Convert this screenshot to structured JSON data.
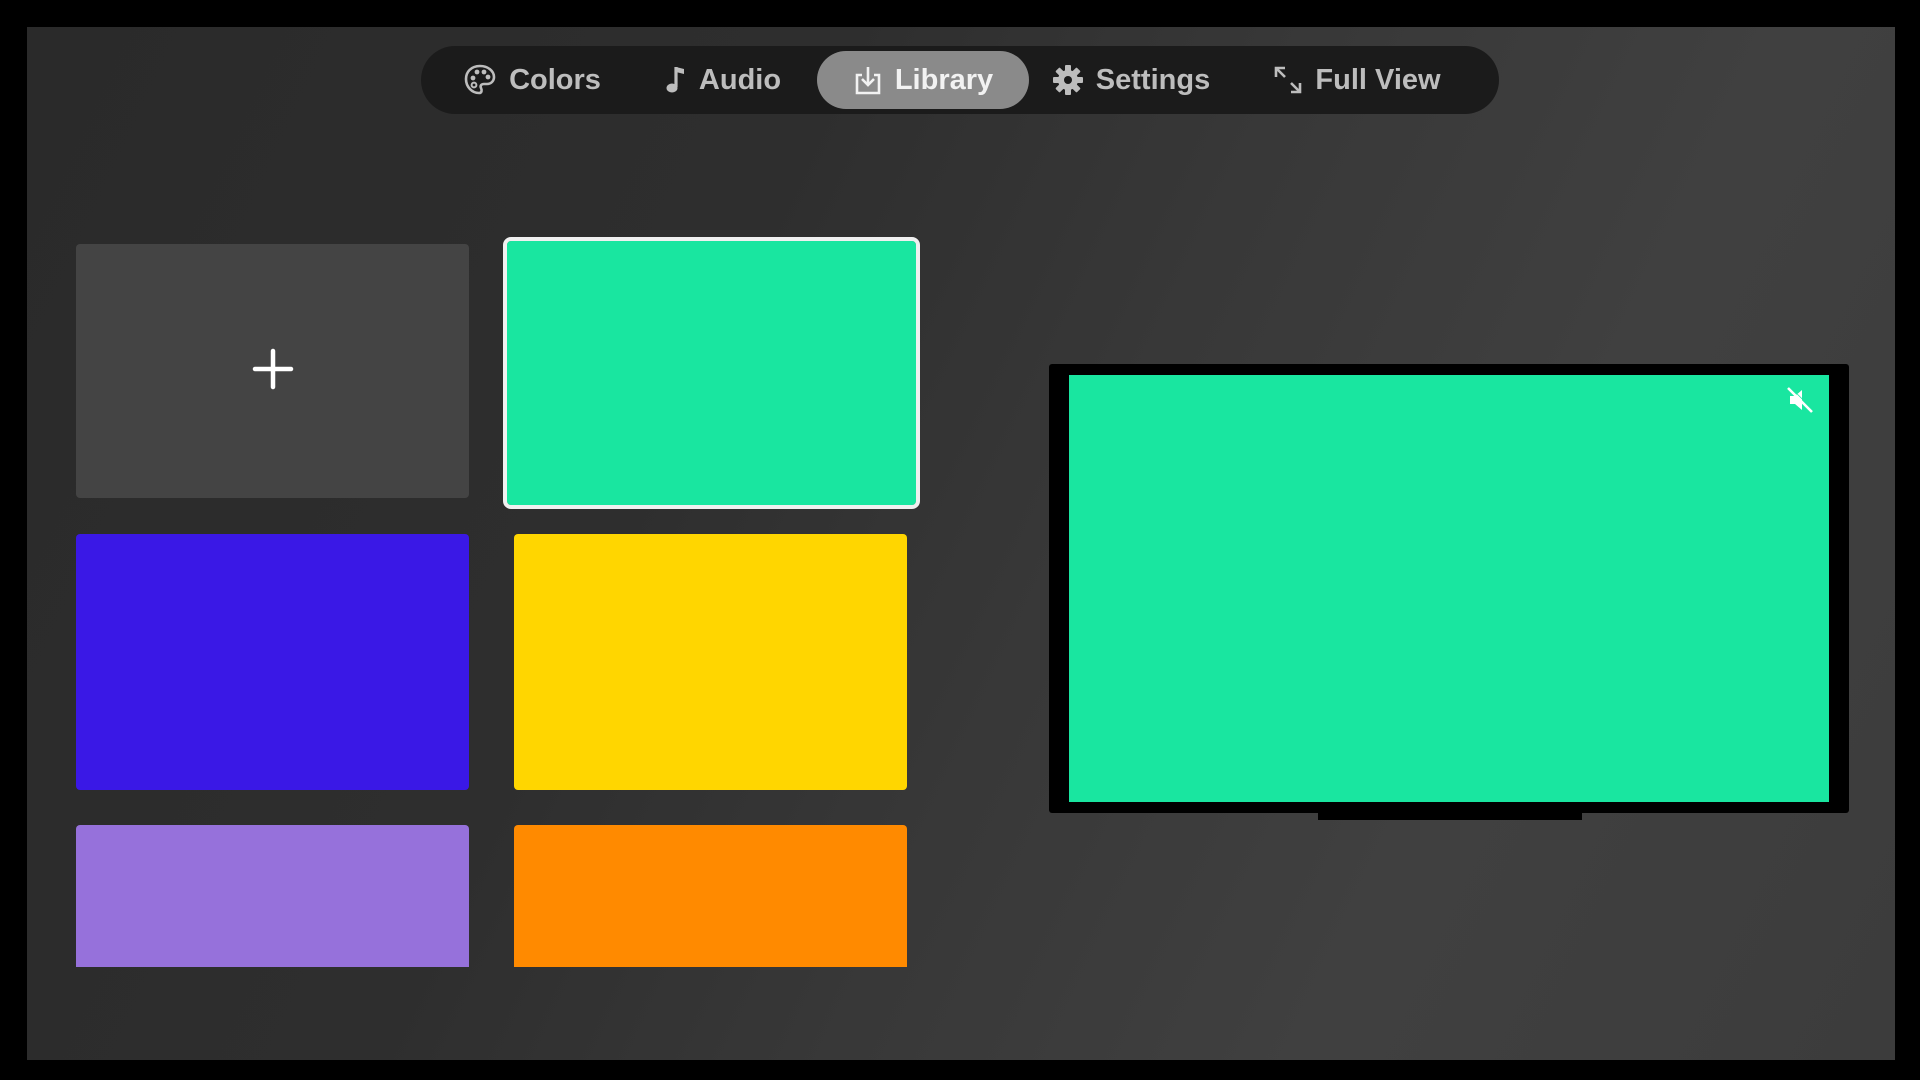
{
  "nav": {
    "items": [
      {
        "label": "Colors",
        "icon": "palette-icon",
        "active": false
      },
      {
        "label": "Audio",
        "icon": "music-note-icon",
        "active": false
      },
      {
        "label": "Library",
        "icon": "download-icon",
        "active": true
      },
      {
        "label": "Settings",
        "icon": "gear-icon",
        "active": false
      },
      {
        "label": "Full View",
        "icon": "expand-icon",
        "active": false
      }
    ]
  },
  "library": {
    "add_icon": "plus-icon",
    "selected_index": 0,
    "tiles": [
      {
        "color": "#19E6A0"
      },
      {
        "color": "#3A18E6"
      },
      {
        "color": "#FFD600"
      },
      {
        "color": "#9671DB"
      },
      {
        "color": "#FF8A00"
      }
    ]
  },
  "preview": {
    "color": "#19E6A0",
    "muted": true,
    "mute_icon": "muted-speaker-icon"
  }
}
